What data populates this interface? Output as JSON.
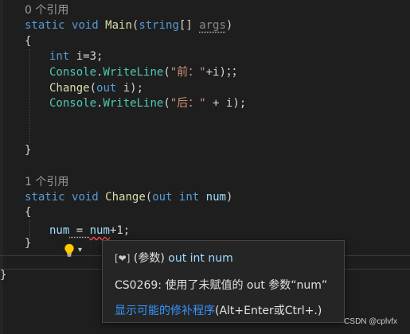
{
  "editor": {
    "main_refs": "0 个引用",
    "main_sig": {
      "kw_static": "static",
      "kw_void": "void",
      "method": "Main",
      "open": "(",
      "type_string": "string",
      "brackets": "[]",
      "space": " ",
      "param": "args",
      "close": ")"
    },
    "brace_open_1": "{",
    "line_int_i": {
      "kw": "int",
      "rest": " i=3;"
    },
    "line_wl_1": {
      "type": "Console",
      "dot": ".",
      "method": "WriteLine",
      "open": "(",
      "str": "\"前：\"",
      "rest": "+i)；；"
    },
    "line_change_call": {
      "method": "Change",
      "open": "(",
      "kw": "out",
      "rest": " i);"
    },
    "line_wl_2": {
      "type": "Console",
      "dot": ".",
      "method": "WriteLine",
      "open": "(",
      "str": "\"后：\"",
      "rest": " + i);"
    },
    "brace_close_1": "}",
    "change_refs": "1 个引用",
    "change_sig": {
      "kw_static": "static",
      "kw_void": "void",
      "method": "Change",
      "open": "(",
      "kw_out": "out",
      "kw_int": "int",
      "param": "num",
      "close": ")"
    },
    "brace_open_2": "{",
    "line_assign": {
      "lhs": "num",
      "op": " = ",
      "rhs": "num",
      "rest": "+1;"
    },
    "brace_close_2": "}",
    "brace_close_3": "}"
  },
  "quick_actions": {
    "icon": "lightbulb-icon",
    "dropdown_icon": "chevron-down-icon",
    "caret": "▾"
  },
  "tooltip": {
    "symbol_icon": "[❤]",
    "symbol_kind": "(参数)",
    "symbol_sig": "out int num",
    "error": "CS0269: 使用了未赋值的 out 参数“num”",
    "fix_link": "显示可能的修补程序",
    "fix_shortcut": "(Alt+Enter或Ctrl+.)"
  },
  "watermark": "CSDN @cplvfx",
  "colors": {
    "background": "#1e1e1e",
    "keyword": "#569cd6",
    "type": "#4ec9b0",
    "method": "#dcdcaa",
    "link": "#3794ff",
    "error_squiggle": "#f14c4c"
  }
}
